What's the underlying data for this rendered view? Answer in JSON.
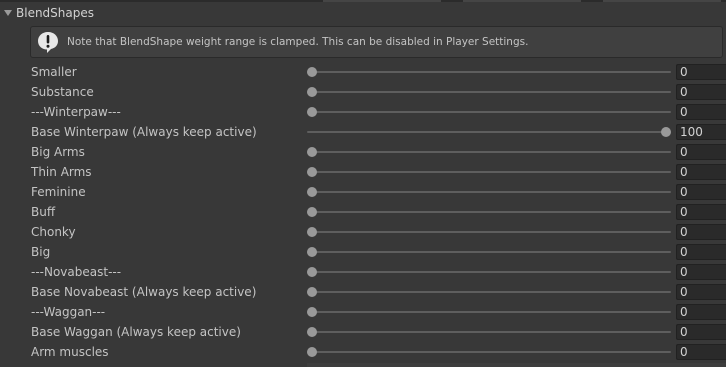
{
  "section": {
    "title": "BlendShapes",
    "expanded": true
  },
  "helpbox": {
    "icon": "info-exclamation-icon",
    "text": "Note that BlendShape weight range is clamped. This can be disabled in Player Settings."
  },
  "slider_range": [
    0,
    100
  ],
  "colors": {
    "background": "#383838",
    "field": "#2a2a2a",
    "thumb": "#999999",
    "track": "#5e5e5e"
  },
  "blendshapes": [
    {
      "label": "Smaller",
      "value": "0"
    },
    {
      "label": "Substance",
      "value": "0"
    },
    {
      "label": "---Winterpaw---",
      "value": "0"
    },
    {
      "label": "Base Winterpaw (Always keep active)",
      "value": "100"
    },
    {
      "label": "Big Arms",
      "value": "0"
    },
    {
      "label": "Thin Arms",
      "value": "0"
    },
    {
      "label": "Feminine",
      "value": "0"
    },
    {
      "label": "Buff",
      "value": "0"
    },
    {
      "label": "Chonky",
      "value": "0"
    },
    {
      "label": "Big",
      "value": "0"
    },
    {
      "label": "---Novabeast---",
      "value": "0"
    },
    {
      "label": "Base Novabeast (Always keep active)",
      "value": "0"
    },
    {
      "label": "---Waggan---",
      "value": "0"
    },
    {
      "label": "Base Waggan (Always keep active)",
      "value": "0"
    },
    {
      "label": "Arm muscles",
      "value": "0"
    }
  ]
}
